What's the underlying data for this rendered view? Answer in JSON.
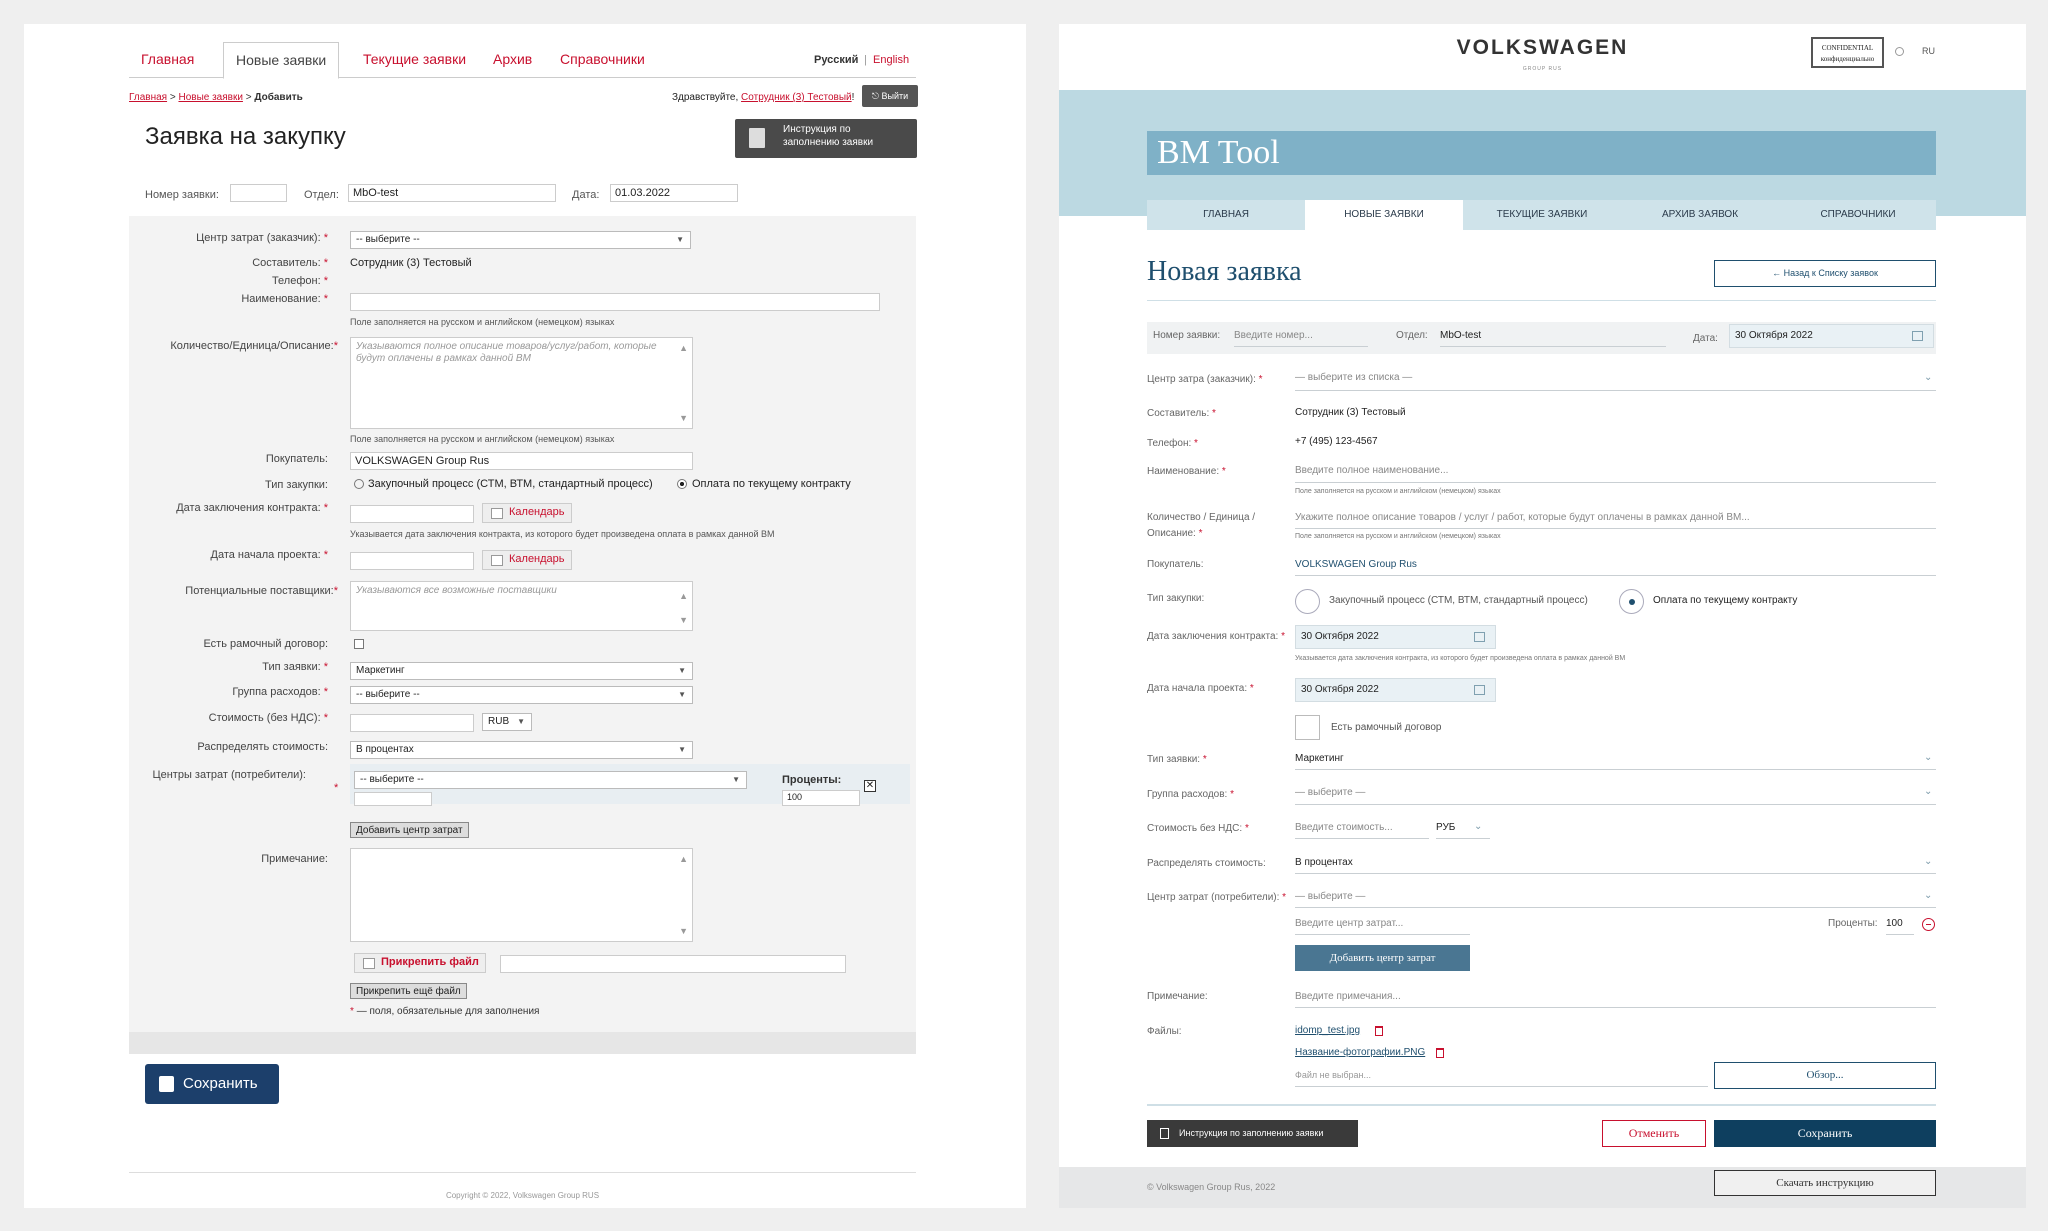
{
  "left": {
    "tabs": [
      "Главная",
      "Новые заявки",
      "Текущие заявки",
      "Архив",
      "Справочники"
    ],
    "lang_ru": "Русский",
    "lang_sep": "|",
    "lang_en": "English",
    "breadcrumb": {
      "home": "Главная",
      "sep1": ">",
      "new": "Новые заявки",
      "sep2": ">",
      "current": "Добавить"
    },
    "greeting_prefix": "Здравствуйте,",
    "greeting_user": "Сотрудник (3) Тестовый",
    "greeting_suffix": "!",
    "exit_label": "Выйти",
    "title": "Заявка на закупку",
    "instruction_label": "Инструкция по заполнению заявки",
    "header": {
      "number_label": "Номер заявки:",
      "number_value": "",
      "dept_label": "Отдел:",
      "dept_value": "MbO-test",
      "date_label": "Дата:",
      "date_value": "01.03.2022"
    },
    "form": {
      "cost_center_label": "Центр затрат (заказчик):",
      "cost_center_value": "-- выберите --",
      "author_label": "Составитель:",
      "author_value": "Сотрудник (3) Тестовый",
      "phone_label": "Телефон:",
      "name_label": "Наименование:",
      "lang_hint": "Поле заполняется на русском и английском (немецком) языках",
      "qty_label": "Количество/Единица/Описание:",
      "qty_placeholder": "Указываются полное описание товаров/услуг/работ, которые будут оплачены в рамках данной ВМ",
      "lang_hint2": "Поле заполняется на русском и английском (немецком) языках",
      "buyer_label": "Покупатель:",
      "buyer_value": "VOLKSWAGEN Group Rus",
      "purchase_type_label": "Тип закупки:",
      "purchase_opt1": "Закупочный процесс (СТМ, ВТМ, стандартный процесс)",
      "purchase_opt2": "Оплата по текущему контракту",
      "contract_date_label": "Дата заключения контракта:",
      "calendar_label": "Календарь",
      "contract_hint": "Указывается дата заключения контракта, из которого будет произведена оплата в рамках данной ВМ",
      "project_date_label": "Дата начала проекта:",
      "calendar_label2": "Календарь",
      "suppliers_label": "Потенциальные поставщики:",
      "suppliers_placeholder": "Указываются все возможные поставщики",
      "frame_label": "Есть рамочный договор:",
      "request_type_label": "Тип заявки:",
      "request_type_value": "Маркетинг",
      "expense_group_label": "Группа расходов:",
      "expense_group_value": "-- выберите --",
      "cost_label": "Стоимость (без НДС):",
      "currency_value": "RUB",
      "distribute_label": "Распределять стоимость:",
      "distribute_value": "В процентах",
      "consumers_label": "Центры затрат (потребители):",
      "consumers_value": "-- выберите --",
      "percent_label": "Проценты:",
      "percent_value": "100",
      "remove_symbol": "✕",
      "add_center_label": "Добавить центр затрат",
      "note_label": "Примечание:",
      "attach_label": "Прикрепить файл",
      "attach_more_label": "Прикрепить ещё файл",
      "required_note": "— поля, обязательные для заполнения",
      "required_mark": "*"
    },
    "save_label": "Сохранить",
    "copyright": "Copyright © 2022, Volkswagen Group RUS"
  },
  "right": {
    "brand": "VOLKSWAGEN",
    "brand_sub": "GROUP RUS",
    "confidential": "CONFIDENTIAL конфиденциально",
    "lang": "RU",
    "app_title": "BM Tool",
    "tabs": [
      "ГЛАВНАЯ",
      "НОВЫЕ ЗАЯВКИ",
      "ТЕКУЩИЕ ЗАЯВКИ",
      "АРХИВ ЗАЯВОК",
      "СПРАВОЧНИКИ"
    ],
    "title": "Новая заявка",
    "back_label": "Назад к Списку заявок",
    "header": {
      "number_label": "Номер заявки:",
      "number_placeholder": "Введите номер...",
      "dept_label": "Отдел:",
      "dept_value": "MbO-test",
      "date_label": "Дата:",
      "date_value": "30 Октября 2022"
    },
    "form": {
      "cost_center_label": "Центр затра (заказчик):",
      "cost_center_value": "— выберите из списка —",
      "author_label": "Составитель:",
      "author_value": "Сотрудник (3) Тестовый",
      "phone_label": "Телефон:",
      "phone_value": "+7 (495) 123-4567",
      "name_label": "Наименование:",
      "name_placeholder": "Введите полное наименование...",
      "lang_hint": "Поле заполняется на русском и английском (немецком) языках",
      "qty_label1": "Количество / Единица /",
      "qty_label2": "Описание:",
      "qty_placeholder": "Укажите полное описание товаров / услуг / работ, которые будут оплачены в рамках данной ВМ...",
      "lang_hint2": "Поле заполняется на русском и английском (немецком) языках",
      "buyer_label": "Покупатель:",
      "buyer_value": "VOLKSWAGEN Group Rus",
      "purchase_type_label": "Тип закупки:",
      "purchase_opt1": "Закупочный процесс (СТМ, ВТМ, стандартный процесс)",
      "purchase_opt2": "Оплата по текущему контракту",
      "contract_date_label": "Дата заключения контракта:",
      "contract_date_value": "30 Октября 2022",
      "contract_hint": "Указывается дата заключения контракта, из которого будет произведена оплата в рамках данной ВМ",
      "project_date_label": "Дата начала проекта:",
      "project_date_value": "30 Октября 2022",
      "frame_label": "Есть рамочный договор",
      "request_type_label": "Тип заявки:",
      "request_type_value": "Маркетинг",
      "expense_group_label": "Группа расходов:",
      "expense_group_value": "— выберите —",
      "cost_label": "Стоимость без НДС:",
      "cost_placeholder": "Введите стоимость...",
      "currency_value": "РУБ",
      "distribute_label": "Распределять стоимость:",
      "distribute_value": "В процентах",
      "consumers_label": "Центр затрат (потребители):",
      "consumers_value": "— выберите —",
      "consumer_input_placeholder": "Введите центр затрат...",
      "percent_label": "Проценты:",
      "percent_value": "100",
      "add_center_label": "Добавить центр затрат",
      "note_label": "Примечание:",
      "note_placeholder": "Введите примечания...",
      "files_label": "Файлы:",
      "file1": "idomp_test.jpg",
      "file2": "Название-фотографии.PNG",
      "no_file": "Файл не выбран...",
      "browse_label": "Обзор...",
      "required_mark": "*"
    },
    "instruction_label": "Инструкция по заполнению заявки",
    "cancel_label": "Отменить",
    "save_label": "Сохранить",
    "copyright": "© Volkswagen Group Rus, 2022",
    "download_label": "Скачать инструкцию"
  },
  "colors": {
    "accent_red": "#c8102e",
    "vw_blue": "#1f4f6e",
    "banner": "#bcd9e2",
    "save_dark": "#1c3f6b"
  }
}
